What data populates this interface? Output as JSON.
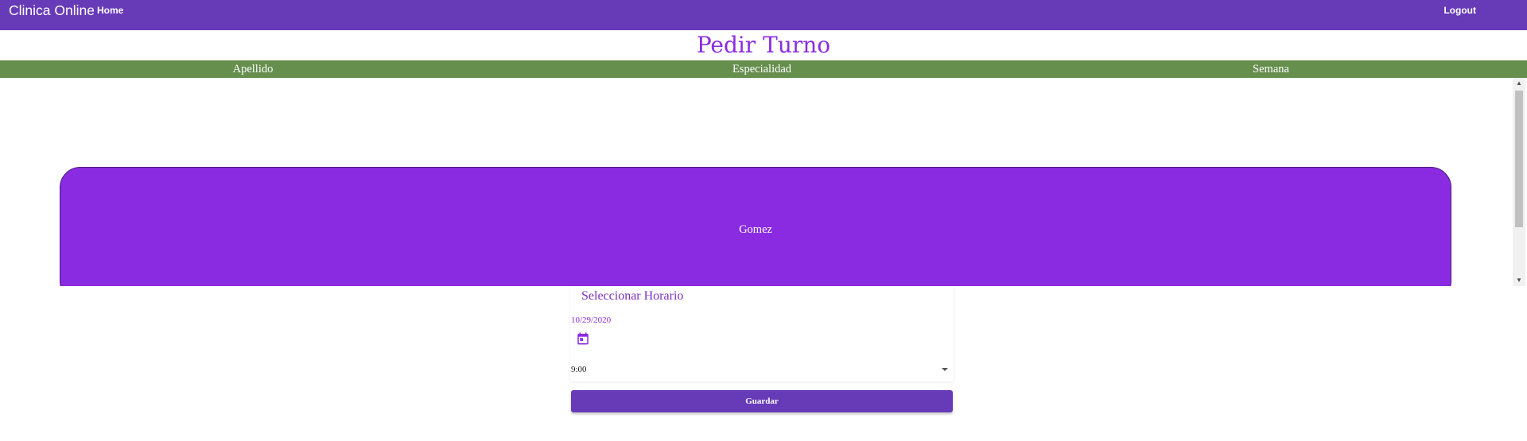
{
  "toolbar": {
    "brand": "Clinica Online",
    "home": "Home",
    "logout": "Logout"
  },
  "page": {
    "title": "Pedir Turno"
  },
  "filters": {
    "columns": [
      "Apellido",
      "Especialidad",
      "Semana"
    ]
  },
  "results": {
    "cards": [
      {
        "apellido": "Gomez"
      }
    ]
  },
  "form": {
    "title": "Seleccionar Horario",
    "date": "10/29/2020",
    "time": "9:00",
    "save_label": "Guardar"
  },
  "colors": {
    "toolbar": "#673ab7",
    "accent": "#8a2be2",
    "band": "#668e4d"
  },
  "icons": {
    "calendar": "calendar-icon",
    "scroll_up": "scroll-up-arrow-icon",
    "scroll_down": "scroll-down-arrow-icon",
    "select_arrow": "chevron-down-icon"
  }
}
